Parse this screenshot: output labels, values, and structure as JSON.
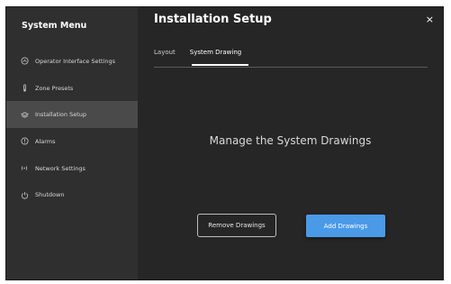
{
  "sidebar": {
    "title": "System Menu",
    "items": [
      {
        "label": "Operator Interface Settings",
        "icon": "gauge-icon"
      },
      {
        "label": "Zone Presets",
        "icon": "thermometer-icon"
      },
      {
        "label": "Installation Setup",
        "icon": "layers-icon",
        "active": true
      },
      {
        "label": "Alarms",
        "icon": "alert-icon"
      },
      {
        "label": "Network Settings",
        "icon": "signal-icon"
      },
      {
        "label": "Shutdown",
        "icon": "power-icon"
      }
    ]
  },
  "main": {
    "title": "Installation Setup",
    "close_label": "×",
    "tabs": [
      {
        "label": "Layout"
      },
      {
        "label": "System Drawing",
        "active": true
      }
    ],
    "headline": "Manage the System Drawings",
    "remove_label": "Remove Drawings",
    "add_label": "Add Drawings"
  },
  "colors": {
    "accent": "#4a9ae8",
    "background": "#262626",
    "sidebar": "#2f2f2f",
    "active_item": "#4a4a4a"
  }
}
